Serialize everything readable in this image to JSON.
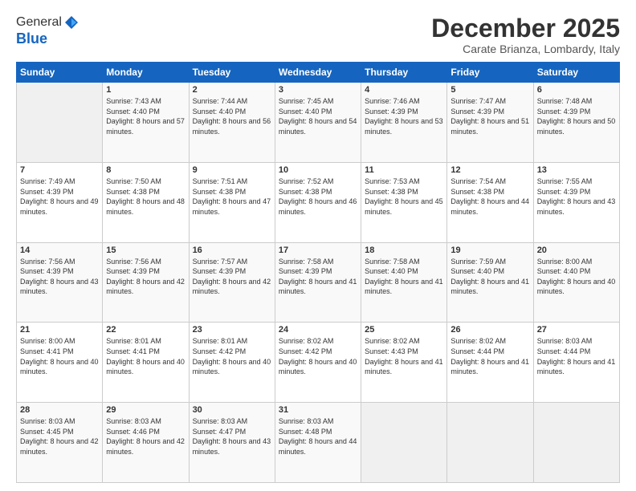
{
  "logo": {
    "general": "General",
    "blue": "Blue"
  },
  "header": {
    "month_title": "December 2025",
    "location": "Carate Brianza, Lombardy, Italy"
  },
  "days_of_week": [
    "Sunday",
    "Monday",
    "Tuesday",
    "Wednesday",
    "Thursday",
    "Friday",
    "Saturday"
  ],
  "weeks": [
    [
      {
        "day": "",
        "sunrise": "",
        "sunset": "",
        "daylight": ""
      },
      {
        "day": "1",
        "sunrise": "Sunrise: 7:43 AM",
        "sunset": "Sunset: 4:40 PM",
        "daylight": "Daylight: 8 hours and 57 minutes."
      },
      {
        "day": "2",
        "sunrise": "Sunrise: 7:44 AM",
        "sunset": "Sunset: 4:40 PM",
        "daylight": "Daylight: 8 hours and 56 minutes."
      },
      {
        "day": "3",
        "sunrise": "Sunrise: 7:45 AM",
        "sunset": "Sunset: 4:40 PM",
        "daylight": "Daylight: 8 hours and 54 minutes."
      },
      {
        "day": "4",
        "sunrise": "Sunrise: 7:46 AM",
        "sunset": "Sunset: 4:39 PM",
        "daylight": "Daylight: 8 hours and 53 minutes."
      },
      {
        "day": "5",
        "sunrise": "Sunrise: 7:47 AM",
        "sunset": "Sunset: 4:39 PM",
        "daylight": "Daylight: 8 hours and 51 minutes."
      },
      {
        "day": "6",
        "sunrise": "Sunrise: 7:48 AM",
        "sunset": "Sunset: 4:39 PM",
        "daylight": "Daylight: 8 hours and 50 minutes."
      }
    ],
    [
      {
        "day": "7",
        "sunrise": "Sunrise: 7:49 AM",
        "sunset": "Sunset: 4:39 PM",
        "daylight": "Daylight: 8 hours and 49 minutes."
      },
      {
        "day": "8",
        "sunrise": "Sunrise: 7:50 AM",
        "sunset": "Sunset: 4:38 PM",
        "daylight": "Daylight: 8 hours and 48 minutes."
      },
      {
        "day": "9",
        "sunrise": "Sunrise: 7:51 AM",
        "sunset": "Sunset: 4:38 PM",
        "daylight": "Daylight: 8 hours and 47 minutes."
      },
      {
        "day": "10",
        "sunrise": "Sunrise: 7:52 AM",
        "sunset": "Sunset: 4:38 PM",
        "daylight": "Daylight: 8 hours and 46 minutes."
      },
      {
        "day": "11",
        "sunrise": "Sunrise: 7:53 AM",
        "sunset": "Sunset: 4:38 PM",
        "daylight": "Daylight: 8 hours and 45 minutes."
      },
      {
        "day": "12",
        "sunrise": "Sunrise: 7:54 AM",
        "sunset": "Sunset: 4:38 PM",
        "daylight": "Daylight: 8 hours and 44 minutes."
      },
      {
        "day": "13",
        "sunrise": "Sunrise: 7:55 AM",
        "sunset": "Sunset: 4:39 PM",
        "daylight": "Daylight: 8 hours and 43 minutes."
      }
    ],
    [
      {
        "day": "14",
        "sunrise": "Sunrise: 7:56 AM",
        "sunset": "Sunset: 4:39 PM",
        "daylight": "Daylight: 8 hours and 43 minutes."
      },
      {
        "day": "15",
        "sunrise": "Sunrise: 7:56 AM",
        "sunset": "Sunset: 4:39 PM",
        "daylight": "Daylight: 8 hours and 42 minutes."
      },
      {
        "day": "16",
        "sunrise": "Sunrise: 7:57 AM",
        "sunset": "Sunset: 4:39 PM",
        "daylight": "Daylight: 8 hours and 42 minutes."
      },
      {
        "day": "17",
        "sunrise": "Sunrise: 7:58 AM",
        "sunset": "Sunset: 4:39 PM",
        "daylight": "Daylight: 8 hours and 41 minutes."
      },
      {
        "day": "18",
        "sunrise": "Sunrise: 7:58 AM",
        "sunset": "Sunset: 4:40 PM",
        "daylight": "Daylight: 8 hours and 41 minutes."
      },
      {
        "day": "19",
        "sunrise": "Sunrise: 7:59 AM",
        "sunset": "Sunset: 4:40 PM",
        "daylight": "Daylight: 8 hours and 41 minutes."
      },
      {
        "day": "20",
        "sunrise": "Sunrise: 8:00 AM",
        "sunset": "Sunset: 4:40 PM",
        "daylight": "Daylight: 8 hours and 40 minutes."
      }
    ],
    [
      {
        "day": "21",
        "sunrise": "Sunrise: 8:00 AM",
        "sunset": "Sunset: 4:41 PM",
        "daylight": "Daylight: 8 hours and 40 minutes."
      },
      {
        "day": "22",
        "sunrise": "Sunrise: 8:01 AM",
        "sunset": "Sunset: 4:41 PM",
        "daylight": "Daylight: 8 hours and 40 minutes."
      },
      {
        "day": "23",
        "sunrise": "Sunrise: 8:01 AM",
        "sunset": "Sunset: 4:42 PM",
        "daylight": "Daylight: 8 hours and 40 minutes."
      },
      {
        "day": "24",
        "sunrise": "Sunrise: 8:02 AM",
        "sunset": "Sunset: 4:42 PM",
        "daylight": "Daylight: 8 hours and 40 minutes."
      },
      {
        "day": "25",
        "sunrise": "Sunrise: 8:02 AM",
        "sunset": "Sunset: 4:43 PM",
        "daylight": "Daylight: 8 hours and 41 minutes."
      },
      {
        "day": "26",
        "sunrise": "Sunrise: 8:02 AM",
        "sunset": "Sunset: 4:44 PM",
        "daylight": "Daylight: 8 hours and 41 minutes."
      },
      {
        "day": "27",
        "sunrise": "Sunrise: 8:03 AM",
        "sunset": "Sunset: 4:44 PM",
        "daylight": "Daylight: 8 hours and 41 minutes."
      }
    ],
    [
      {
        "day": "28",
        "sunrise": "Sunrise: 8:03 AM",
        "sunset": "Sunset: 4:45 PM",
        "daylight": "Daylight: 8 hours and 42 minutes."
      },
      {
        "day": "29",
        "sunrise": "Sunrise: 8:03 AM",
        "sunset": "Sunset: 4:46 PM",
        "daylight": "Daylight: 8 hours and 42 minutes."
      },
      {
        "day": "30",
        "sunrise": "Sunrise: 8:03 AM",
        "sunset": "Sunset: 4:47 PM",
        "daylight": "Daylight: 8 hours and 43 minutes."
      },
      {
        "day": "31",
        "sunrise": "Sunrise: 8:03 AM",
        "sunset": "Sunset: 4:48 PM",
        "daylight": "Daylight: 8 hours and 44 minutes."
      },
      {
        "day": "",
        "sunrise": "",
        "sunset": "",
        "daylight": ""
      },
      {
        "day": "",
        "sunrise": "",
        "sunset": "",
        "daylight": ""
      },
      {
        "day": "",
        "sunrise": "",
        "sunset": "",
        "daylight": ""
      }
    ]
  ]
}
